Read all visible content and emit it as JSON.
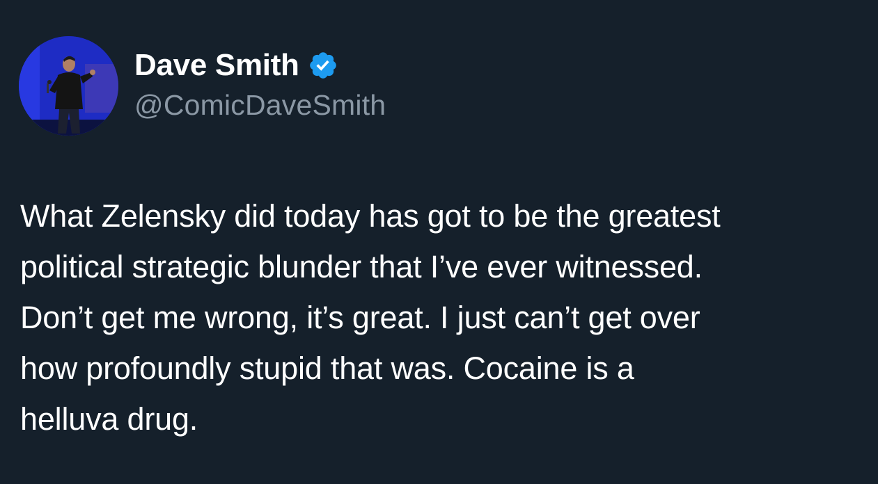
{
  "colors": {
    "background": "#15202b",
    "text_primary": "#ffffff",
    "text_secondary": "#8b98a5",
    "verified_badge": "#1d9bf0"
  },
  "author": {
    "display_name": "Dave Smith",
    "handle": "@ComicDaveSmith",
    "verified": true,
    "avatar_icon": "user-avatar-photo",
    "badge_icon": "verified-badge-icon"
  },
  "tweet": {
    "lines": [
      "What Zelensky did today has got to be the greatest",
      "political strategic blunder that I’ve ever witnessed.",
      "Don’t get me wrong, it’s great. I just can’t get over",
      "how profoundly stupid that was. Cocaine is a",
      "helluva drug."
    ]
  }
}
